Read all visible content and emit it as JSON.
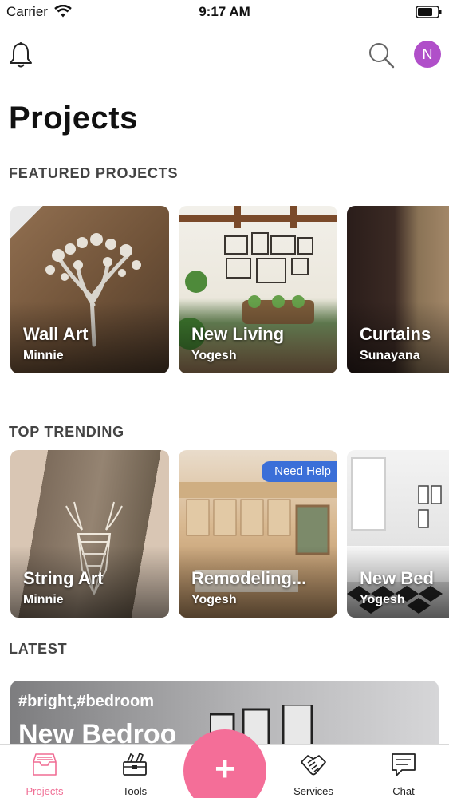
{
  "status_bar": {
    "carrier": "Carrier",
    "time": "9:17 AM"
  },
  "header": {
    "avatar_initial": "N",
    "title": "Projects"
  },
  "sections": {
    "featured": {
      "heading": "FEATURED PROJECTS",
      "cards": [
        {
          "title": "Wall Art",
          "author": "Minnie"
        },
        {
          "title": "New Living",
          "author": "Yogesh"
        },
        {
          "title": "Curtains",
          "author": "Sunayana"
        }
      ]
    },
    "trending": {
      "heading": "TOP TRENDING",
      "cards": [
        {
          "title": "String Art",
          "author": "Minnie"
        },
        {
          "title": "Remodeling...",
          "author": "Yogesh",
          "badge": "Need Help"
        },
        {
          "title": "New Bed",
          "author": "Yogesh"
        }
      ]
    },
    "latest": {
      "heading": "LATEST",
      "card": {
        "tags": "#bright,#bedroom",
        "title": "New Bedroo"
      }
    }
  },
  "tab_bar": {
    "tabs": [
      {
        "label": "Projects",
        "icon": "inbox-tray-icon",
        "active": true
      },
      {
        "label": "Tools",
        "icon": "toolbox-icon"
      },
      {
        "label": "Services",
        "icon": "handshake-icon"
      },
      {
        "label": "Chat",
        "icon": "chat-bubble-icon"
      }
    ],
    "fab_label": "+"
  },
  "colors": {
    "accent": "#f46e98",
    "avatar": "#b04fc9",
    "badge": "#3b6fd8"
  }
}
